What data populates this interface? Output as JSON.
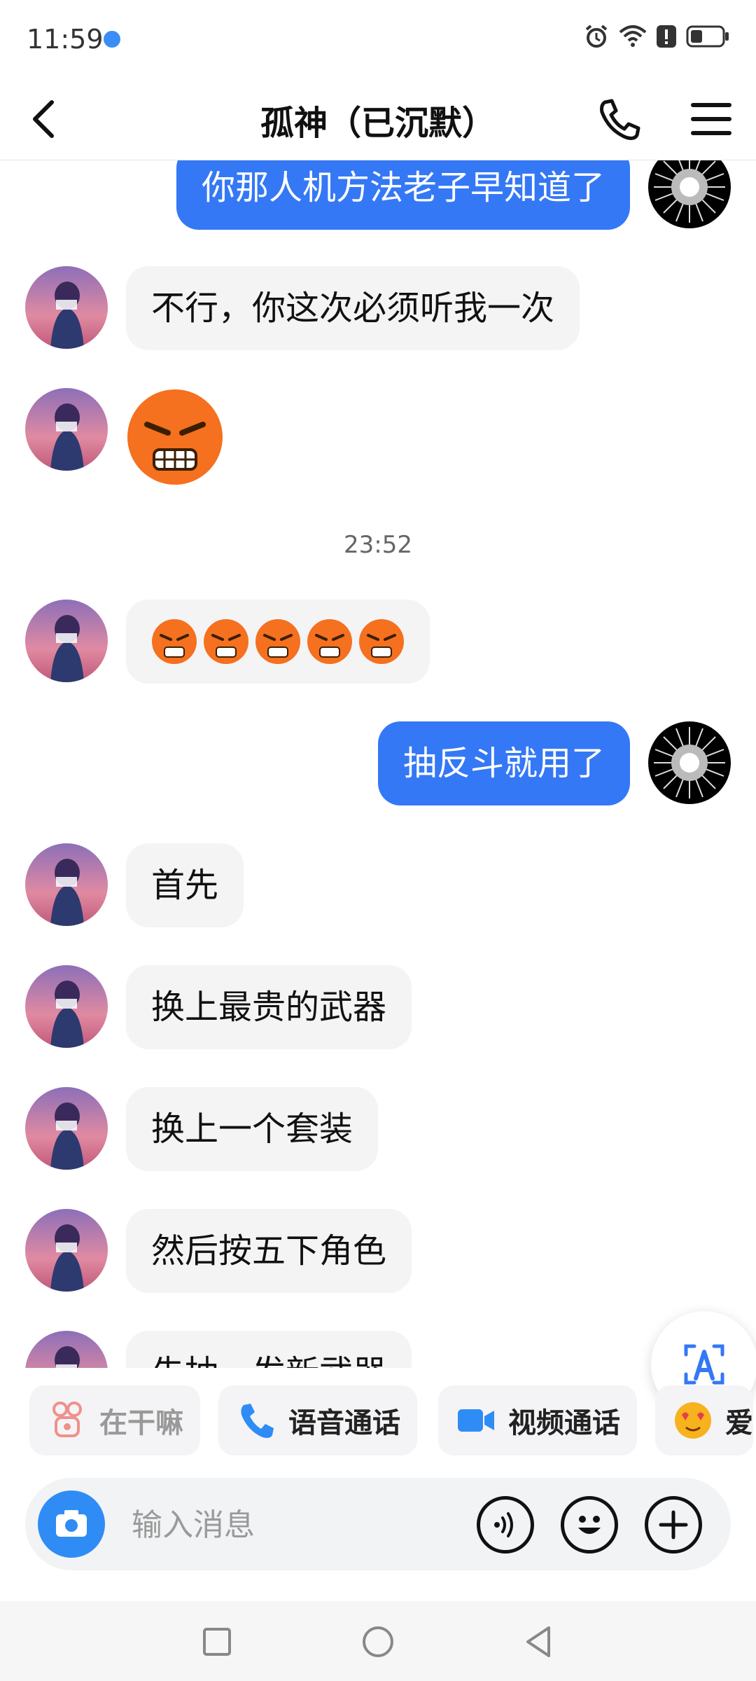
{
  "status_bar": {
    "time": "11:59",
    "icons": [
      "alarm-icon",
      "wifi-icon",
      "alert-icon",
      "battery-icon"
    ]
  },
  "header": {
    "title": "孤神（已沉默）"
  },
  "messages": [
    {
      "side": "out",
      "text": "你那人机方法老子早知道了"
    },
    {
      "side": "in",
      "text": "不行，你这次必须听我一次"
    },
    {
      "side": "in",
      "emoji": "angry-face-large"
    },
    {
      "timestamp": "23:52"
    },
    {
      "side": "in",
      "emoji": "angry-face-x5"
    },
    {
      "side": "out",
      "text": "抽反斗就用了"
    },
    {
      "side": "in",
      "text": "首先"
    },
    {
      "side": "in",
      "text": "换上最贵的武器"
    },
    {
      "side": "in",
      "text": "换上一个套装"
    },
    {
      "side": "in",
      "text": "然后按五下角色"
    },
    {
      "side": "in",
      "text": "先抽一发新武器"
    }
  ],
  "quick_actions": [
    {
      "label": "在干嘛",
      "icon": "poke-icon"
    },
    {
      "label": "语音通话",
      "icon": "phone-icon"
    },
    {
      "label": "视频通话",
      "icon": "video-icon"
    },
    {
      "label": "爱",
      "icon": "love-emoji-icon"
    }
  ],
  "input": {
    "placeholder": "输入消息"
  },
  "colors": {
    "accent": "#3478f6",
    "incoming_bubble": "#f4f4f4",
    "camera": "#2f8cf5",
    "emoji": "#f5701f"
  }
}
